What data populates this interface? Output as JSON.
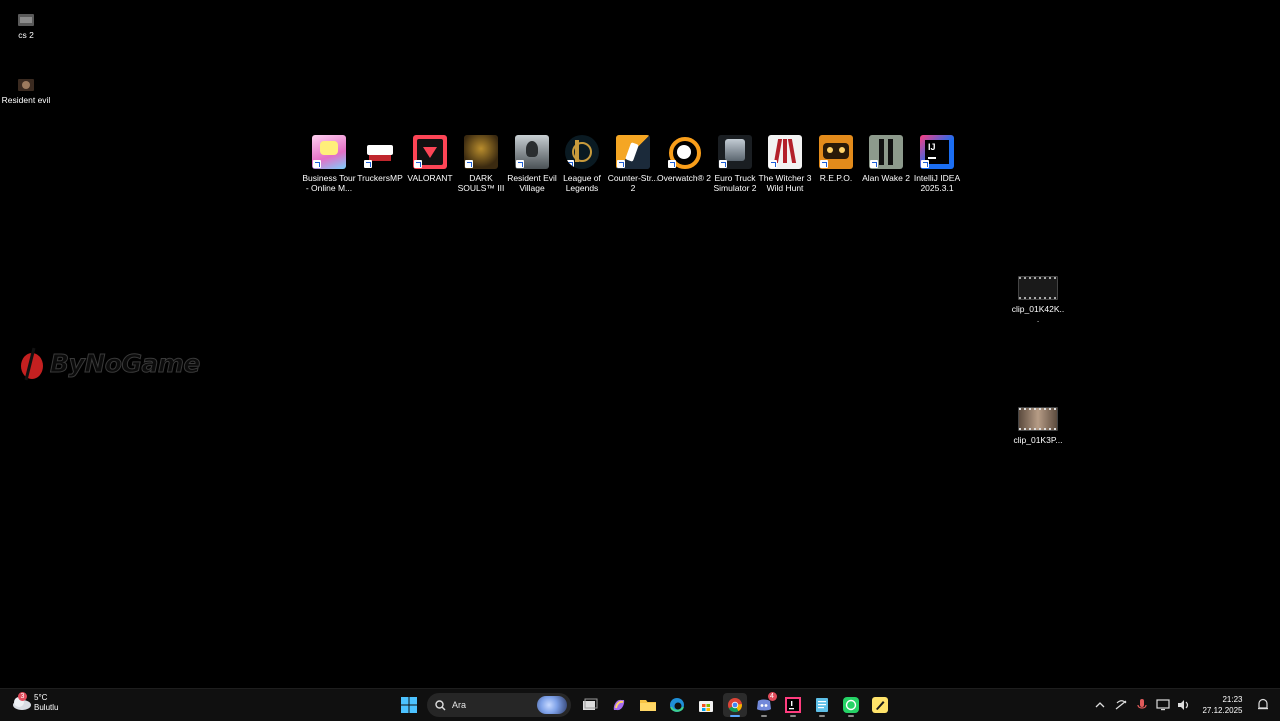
{
  "desktop": {
    "left_icons": [
      {
        "label": "cs 2",
        "icon": "cs2-video-thumbnail-icon",
        "color": "#6b6b6b"
      },
      {
        "label": "Resident evil",
        "icon": "resident-evil-thumbnail-icon",
        "color": "#7a5a44"
      }
    ],
    "row_icons": [
      {
        "label": "Business Tour - Online M...",
        "icon": "business-tour-icon",
        "color": "#e77fd0"
      },
      {
        "label": "TruckersMP",
        "icon": "truckersmp-icon",
        "color": "#ffffff"
      },
      {
        "label": "VALORANT",
        "icon": "valorant-icon",
        "color": "#fd4556"
      },
      {
        "label": "DARK SOULS™ III",
        "icon": "dark-souls-iii-icon",
        "color": "#8a6a1f"
      },
      {
        "label": "Resident Evil Village",
        "icon": "resident-evil-village-icon",
        "color": "#9aa3a8"
      },
      {
        "label": "League of Legends",
        "icon": "league-of-legends-icon",
        "color": "#c89b3c"
      },
      {
        "label": "Counter-Str... 2",
        "icon": "counter-strike-2-icon",
        "color": "#f5a623"
      },
      {
        "label": "Overwatch® 2",
        "icon": "overwatch-2-icon",
        "color": "#f99e1a"
      },
      {
        "label": "Euro Truck Simulator 2",
        "icon": "euro-truck-simulator-2-icon",
        "color": "#7c8a99"
      },
      {
        "label": "The Witcher 3 Wild Hunt",
        "icon": "witcher-3-icon",
        "color": "#b3202a"
      },
      {
        "label": "R.E.P.O.",
        "icon": "repo-icon",
        "color": "#e38b1b"
      },
      {
        "label": "Alan Wake 2",
        "icon": "alan-wake-2-icon",
        "color": "#8d9a8c"
      },
      {
        "label": "IntelliJ IDEA 2025.3.1",
        "icon": "intellij-idea-icon",
        "color": "#1b6ef3"
      }
    ],
    "right_icons": [
      {
        "label": "clip_01K42K...",
        "icon": "video-clip-icon",
        "color": "#2a2a2a"
      },
      {
        "label": "clip_01K3P...",
        "icon": "video-clip-icon",
        "color": "#8e7a6a"
      }
    ],
    "watermark": {
      "text": "ByNoGame",
      "icon": "bynogame-logo-icon",
      "accent": "#d42b2b"
    }
  },
  "taskbar": {
    "weather": {
      "temp": "5°C",
      "condition": "Bulutlu",
      "badge": "3"
    },
    "search": {
      "placeholder": "Ara"
    },
    "apps": [
      {
        "name": "start",
        "icon": "windows-start-icon",
        "active": false
      },
      {
        "name": "search",
        "icon": "search-icon"
      },
      {
        "name": "task-view",
        "icon": "task-view-icon",
        "active": false
      },
      {
        "name": "copilot",
        "icon": "copilot-icon",
        "active": false
      },
      {
        "name": "file-explorer",
        "icon": "folder-icon",
        "active": false
      },
      {
        "name": "edge",
        "icon": "edge-icon",
        "active": false
      },
      {
        "name": "store",
        "icon": "store-icon",
        "active": false
      },
      {
        "name": "chrome",
        "icon": "chrome-icon",
        "active": true
      },
      {
        "name": "discord",
        "icon": "discord-icon",
        "active": false,
        "badge": "4"
      },
      {
        "name": "intellij",
        "icon": "intellij-icon",
        "active": false
      },
      {
        "name": "notepad",
        "icon": "notepad-icon",
        "active": false
      },
      {
        "name": "whatsapp",
        "icon": "whatsapp-icon",
        "active": false
      },
      {
        "name": "app-misc",
        "icon": "pen-app-icon",
        "active": false
      }
    ],
    "clock": {
      "time": "21:23",
      "date": "27.12.2025"
    }
  }
}
